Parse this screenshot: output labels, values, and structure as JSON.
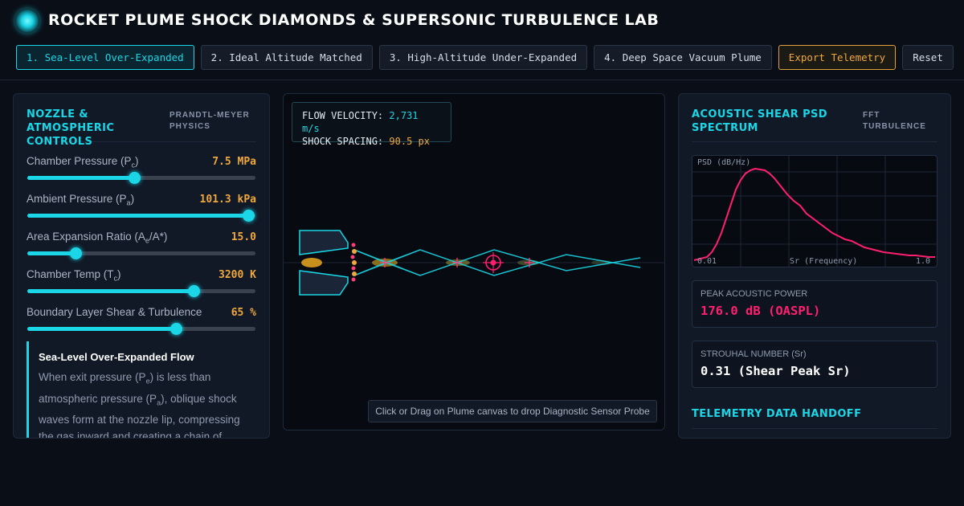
{
  "app": {
    "title": "ROCKET PLUME SHOCK DIAMONDS & SUPERSONIC TURBULENCE LAB"
  },
  "tabs": [
    {
      "label": "1. Sea-Level Over-Expanded",
      "active": true
    },
    {
      "label": "2. Ideal Altitude Matched",
      "active": false
    },
    {
      "label": "3. High-Altitude Under-Expanded",
      "active": false
    },
    {
      "label": "4. Deep Space Vacuum Plume",
      "active": false
    }
  ],
  "toolbar": {
    "export_label": "Export Telemetry",
    "reset_label": "Reset"
  },
  "controls_panel": {
    "title": "NOZZLE & ATMOSPHERIC CONTROLS",
    "subtitle": "PRANDTL-MEYER PHYSICS",
    "sliders": [
      {
        "label_main": "Chamber Pressure (P",
        "label_sub": "c",
        "label_end": ")",
        "value": "7.5 MPa",
        "level": 0.47
      },
      {
        "label_main": "Ambient Pressure (P",
        "label_sub": "a",
        "label_end": ")",
        "value": "101.3 kPa",
        "level": 0.97
      },
      {
        "label_main": "Area Expansion Ratio (A",
        "label_sub": "e",
        "label_end": "/A*)",
        "value": "15.0",
        "level": 0.21
      },
      {
        "label_main": "Chamber Temp (T",
        "label_sub": "c",
        "label_end": ")",
        "value": "3200 K",
        "level": 0.73
      },
      {
        "label_main": "Boundary Layer Shear & Turbulence",
        "label_sub": "",
        "label_end": "",
        "value": "65 %",
        "level": 0.65
      }
    ],
    "info": {
      "title": "Sea-Level Over-Expanded Flow",
      "body_1": "When exit pressure (P",
      "body_1_sub": "e",
      "body_2": ") is less than atmospheric pressure (P",
      "body_2_sub": "a",
      "body_3": "), oblique shock waves form at the nozzle lip, compressing the gas inward and creating a chain of"
    }
  },
  "canvas": {
    "readout": {
      "velocity_label": "FLOW VELOCITY:",
      "velocity_value": "2,731 m/s",
      "spacing_label": "SHOCK SPACING:",
      "spacing_value": "90.5 px"
    },
    "hint": "Click or Drag on Plume canvas to drop Diagnostic Sensor Probe"
  },
  "acoustic_panel": {
    "title": "ACOUSTIC SHEAR PSD SPECTRUM",
    "subtitle": "FFT TURBULENCE",
    "psd": {
      "y_label": "PSD (dB/Hz)",
      "x_min_label": "0.01",
      "x_label": "Sr (Frequency)",
      "x_max_label": "1.0"
    },
    "peak_power": {
      "label": "PEAK ACOUSTIC POWER",
      "value": "176.0 dB (OASPL)"
    },
    "strouhal": {
      "label": "STROUHAL NUMBER (Sr)",
      "value": "0.31 (Shear Peak Sr)"
    },
    "handoff_title": "TELEMETRY DATA HANDOFF"
  },
  "colors": {
    "accent": "#1ad6e6",
    "warning": "#f0a83d",
    "alert": "#ff1f6e",
    "background": "#0a0e17"
  }
}
